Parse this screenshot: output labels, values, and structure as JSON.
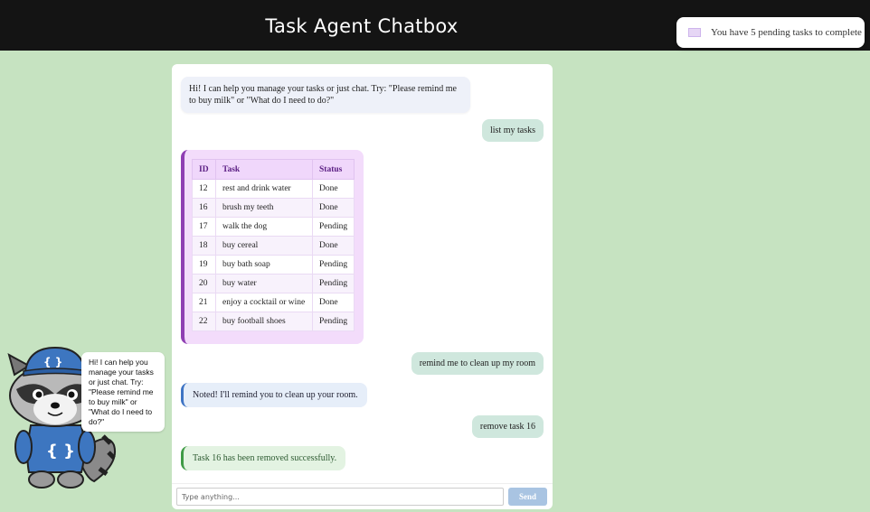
{
  "header": {
    "title": "Task Agent Chatbox"
  },
  "notification": {
    "text": "You have 5 pending tasks to complete"
  },
  "messages": {
    "greeting": "Hi! I can help you manage your tasks or just chat. Try: \"Please remind me to buy milk\" or \"What do I need to do?\"",
    "user1": "list my tasks",
    "user2": "remind me to clean up my room",
    "bot_note": "Noted! I'll remind you to clean up your room.",
    "user3": "remove task 16",
    "bot_ok": "Task 16 has been removed successfully."
  },
  "task_table": {
    "headers": [
      "ID",
      "Task",
      "Status"
    ],
    "rows": [
      [
        "12",
        "rest and drink water",
        "Done"
      ],
      [
        "16",
        "brush my teeth",
        "Done"
      ],
      [
        "17",
        "walk the dog",
        "Pending"
      ],
      [
        "18",
        "buy cereal",
        "Done"
      ],
      [
        "19",
        "buy bath soap",
        "Pending"
      ],
      [
        "20",
        "buy water",
        "Pending"
      ],
      [
        "21",
        "enjoy a cocktail or wine",
        "Done"
      ],
      [
        "22",
        "buy football shoes",
        "Pending"
      ]
    ]
  },
  "input": {
    "placeholder": "Type anything...",
    "send_label": "Send"
  },
  "mascot": {
    "icon": "raccoon-mascot-icon",
    "speech": "Hi! I can help you manage your tasks or just chat. Try: \"Please remind me to buy milk\" or \"What do I need to do?\""
  },
  "colors": {
    "background": "#c6e3c1",
    "header": "#141414",
    "table_accent": "#8f3fb3",
    "send_button": "#a9c4e2"
  }
}
